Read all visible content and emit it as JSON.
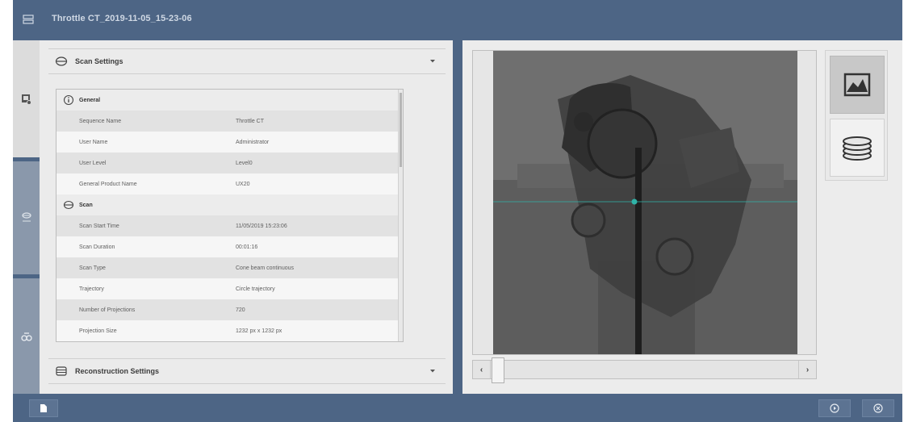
{
  "window": {
    "title": "Throttle CT_2019-11-05_15-23-06",
    "accent_color": "#4d6585",
    "title_icon": "scanner-icon"
  },
  "nav": [
    {
      "icon": "image-settings-icon"
    },
    {
      "icon": "scan-icon"
    },
    {
      "icon": "binoculars-icon"
    }
  ],
  "scan_settings": {
    "label": "Scan Settings",
    "icon": "scan-settings-icon",
    "groups": [
      {
        "label": "General",
        "icon": "info-icon",
        "rows": [
          {
            "key": "Sequence Name",
            "value": "Throttle CT"
          },
          {
            "key": "User Name",
            "value": "Administrator"
          },
          {
            "key": "User Level",
            "value": "Level0"
          },
          {
            "key": "General Product Name",
            "value": "UX20"
          }
        ]
      },
      {
        "label": "Scan",
        "icon": "scan-icon",
        "rows": [
          {
            "key": "Scan Start Time",
            "value": "11/05/2019 15:23:06"
          },
          {
            "key": "Scan Duration",
            "value": "00:01:16"
          },
          {
            "key": "Scan Type",
            "value": "Cone beam continuous"
          },
          {
            "key": "Trajectory",
            "value": "Circle trajectory"
          },
          {
            "key": "Number of Projections",
            "value": "720"
          },
          {
            "key": "Projection Size",
            "value": "1232 px x 1232 px"
          }
        ]
      }
    ]
  },
  "reconstruction_settings": {
    "label": "Reconstruction Settings",
    "icon": "reconstruction-icon"
  },
  "viewer": {
    "crosshair_color": "#2fb3a8",
    "slider_position": 0.02
  },
  "tools": [
    {
      "icon": "projection-image-icon",
      "active": true
    },
    {
      "icon": "volume-stack-icon",
      "active": false
    }
  ],
  "status_bar": {
    "left_icon": "document-icon",
    "right_icons": [
      "play-icon",
      "close-icon"
    ]
  }
}
